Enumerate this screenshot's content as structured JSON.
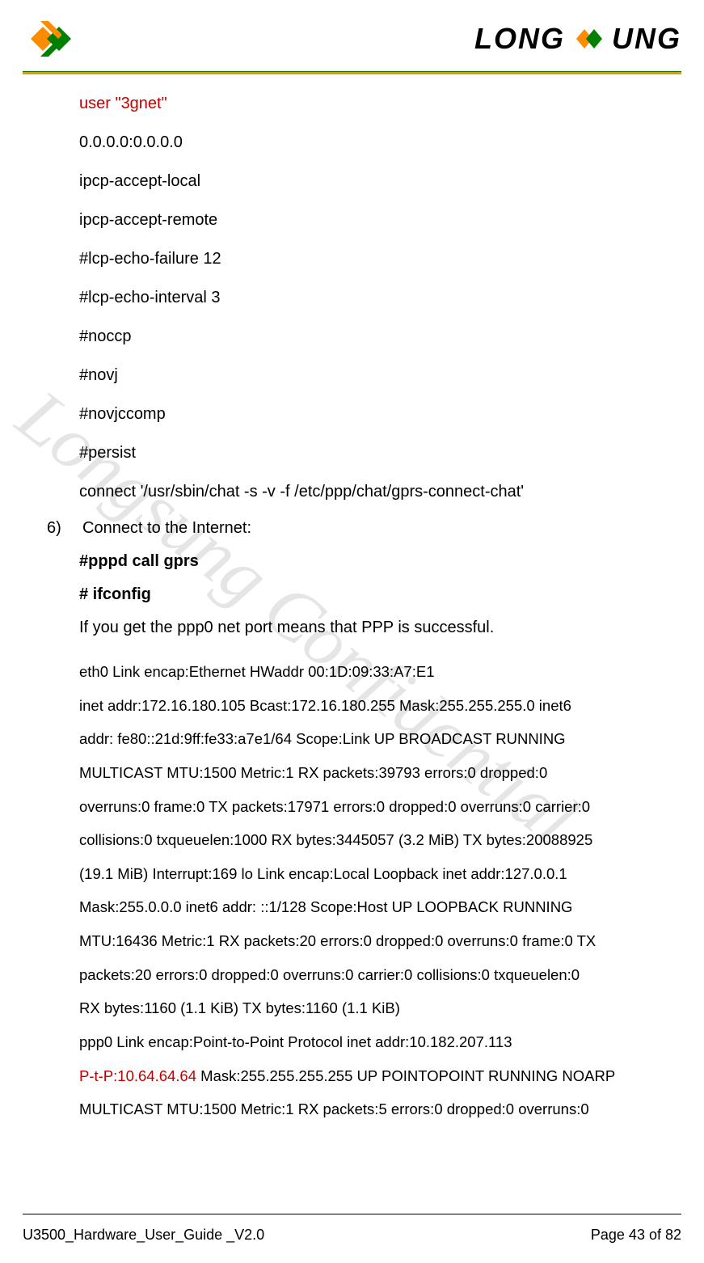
{
  "brand": {
    "left": "LONG",
    "right": "UNG"
  },
  "config": {
    "l1": "user \"3gnet\"",
    "l2": "0.0.0.0:0.0.0.0",
    "l3": "ipcp-accept-local",
    "l4": "ipcp-accept-remote",
    "l5": "#lcp-echo-failure   12",
    "l6": "#lcp-echo-interval 3",
    "l7": "#noccp",
    "l8": "#novj",
    "l9": "#novjccomp",
    "l10": "#persist",
    "l11": "connect '/usr/sbin/chat -s -v -f /etc/ppp/chat/gprs-connect-chat'"
  },
  "step": {
    "num": "6)",
    "text": "Connect to the Internet:"
  },
  "cmds": {
    "c1": "#pppd call gprs",
    "c2": "# ifconfig"
  },
  "note": "If you get the ppp0 net port means that PPP is successful.",
  "ifcfg": {
    "p1": "eth0 Link encap:Ethernet   HWaddr 00:1D:09:33:A7:E1",
    "p2": "inet addr:172.16.180.105   Bcast:172.16.180.255 Mask:255.255.255.0   inet6",
    "p3": "addr: fe80::21d:9ff:fe33:a7e1/64 Scope:Link    UP BROADCAST RUNNING",
    "p4": "MULTICAST   MTU:1500 Metric:1    RX packets:39793 errors:0 dropped:0",
    "p5": "overruns:0 frame:0    TX packets:17971 errors:0 dropped:0 overruns:0 carrier:0",
    "p6": "collisions:0 txqueuelen:1000   RX bytes:3445057 (3.2 MiB)   TX bytes:20088925",
    "p7": "(19.1 MiB)    Interrupt:169 lo Link encap:Local Loopback   inet addr:127.0.0.1",
    "p8": "Mask:255.0.0.0   inet6 addr: ::1/128 Scope:Host   UP LOOPBACK RUNNING",
    "p9": "MTU:16436 Metric:1   RX packets:20 errors:0 dropped:0 overruns:0 frame:0    TX",
    "p10": "packets:20 errors:0 dropped:0 overruns:0 carrier:0    collisions:0 txqueuelen:0",
    "p11": "RX bytes:1160 (1.1 KiB)   TX bytes:1160 (1.1 KiB)",
    "p12": "ppp0   Link encap:Point-to-Point Protocol   inet addr:10.182.207.113",
    "p13a": "P-t-P:10.64.64.64",
    "p13b": " Mask:255.255.255.255   UP POINTOPOINT RUNNING NOARP",
    "p14": "MULTICAST   MTU:1500 Metric:1   RX packets:5 errors:0 dropped:0 overruns:0"
  },
  "watermark": "Longsung Confidential",
  "footer": {
    "left": "U3500_Hardware_User_Guide _V2.0",
    "right": "Page 43 of 82"
  }
}
